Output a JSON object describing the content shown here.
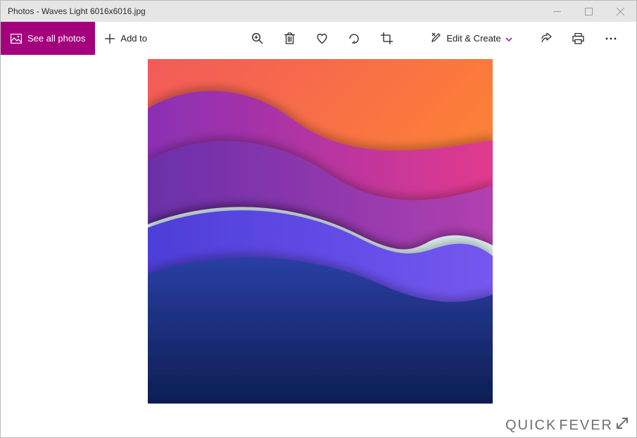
{
  "window": {
    "title": "Photos - Waves Light 6016x6016.jpg"
  },
  "toolbar": {
    "see_all_photos_label": "See all photos",
    "add_to_label": "Add to",
    "edit_create_label": "Edit & Create"
  },
  "watermark": {
    "text_light": "QUICK",
    "text_bold": "FEVER"
  },
  "icons": {
    "zoom": "zoom-icon",
    "delete": "delete-icon",
    "favorite": "favorite-icon",
    "rotate": "rotate-icon",
    "crop": "crop-icon",
    "paint": "paint-icon",
    "share": "share-icon",
    "print": "print-icon",
    "more": "more-icon",
    "add": "add-icon",
    "photos": "photos-icon"
  },
  "accent_color": "#a4007e"
}
